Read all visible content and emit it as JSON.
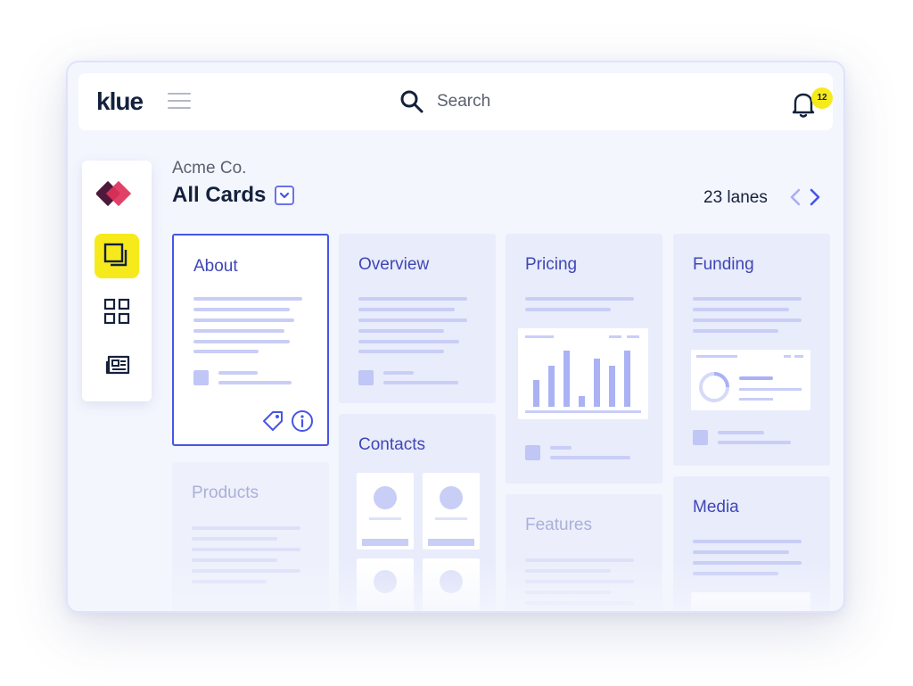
{
  "app": {
    "logo_text": "klue"
  },
  "search": {
    "placeholder": "Search"
  },
  "notifications": {
    "count": "12"
  },
  "sidebar": {
    "items": [
      {
        "name": "brand-logo"
      },
      {
        "name": "cards",
        "active": true
      },
      {
        "name": "dashboard"
      },
      {
        "name": "news"
      }
    ]
  },
  "header": {
    "company": "Acme Co.",
    "title": "All Cards",
    "lanes": "23 lanes"
  },
  "cards": {
    "about": "About",
    "overview": "Overview",
    "pricing": "Pricing",
    "funding": "Funding",
    "products": "Products",
    "contacts": "Contacts",
    "features": "Features",
    "media": "Media"
  },
  "colors": {
    "accent": "#4655e4",
    "highlight": "#f7ea1c",
    "text_dark": "#14213d",
    "card_bg": "#e9ecfb"
  },
  "icons": [
    "menu-icon",
    "search-icon",
    "bell-icon",
    "cards-icon",
    "grid-icon",
    "news-icon",
    "tag-icon",
    "info-icon",
    "chevron-left-icon",
    "chevron-right-icon",
    "chevron-down-icon"
  ]
}
